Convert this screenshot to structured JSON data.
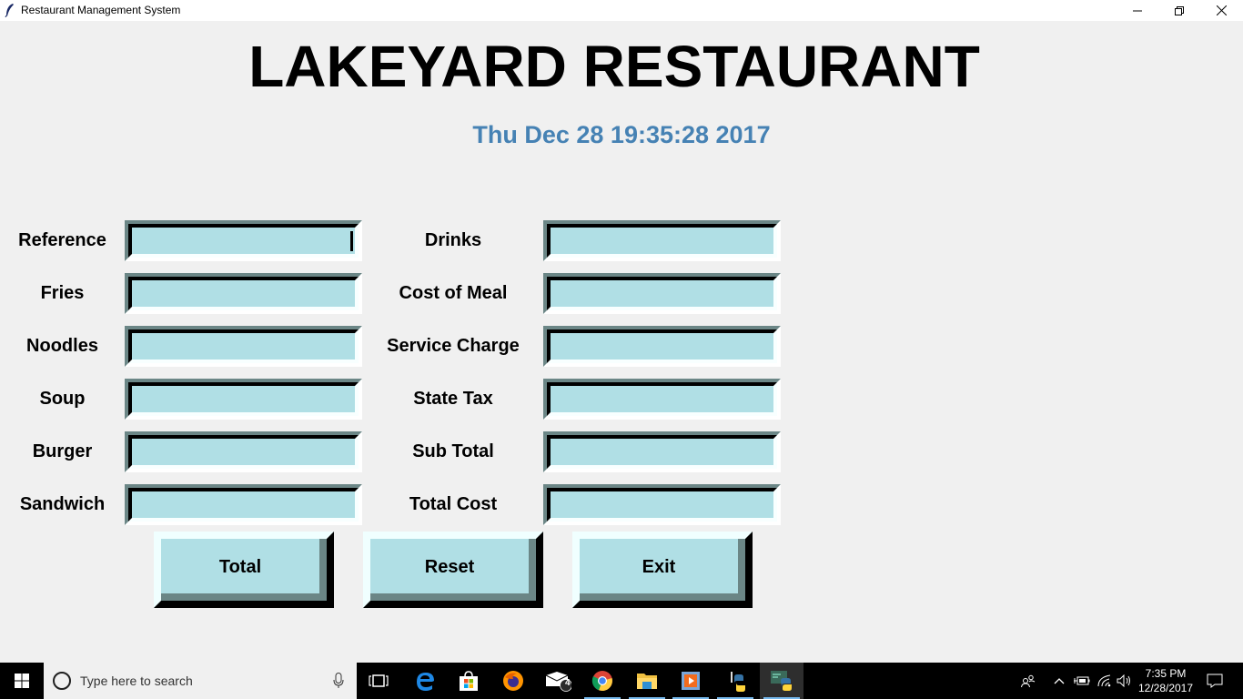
{
  "window": {
    "title": "Restaurant Management System",
    "icon": "feather-icon",
    "controls": [
      "minimize",
      "restore",
      "close"
    ]
  },
  "header": {
    "title": "LAKEYARD RESTAURANT",
    "datetime": "Thu Dec 28 19:35:28 2017",
    "datetime_color": "#4682b4"
  },
  "form": {
    "left": [
      {
        "label": "Reference",
        "value": ""
      },
      {
        "label": "Fries",
        "value": ""
      },
      {
        "label": "Noodles",
        "value": ""
      },
      {
        "label": "Soup",
        "value": ""
      },
      {
        "label": "Burger",
        "value": ""
      },
      {
        "label": "Sandwich",
        "value": ""
      }
    ],
    "right": [
      {
        "label": "Drinks",
        "value": ""
      },
      {
        "label": "Cost of Meal",
        "value": ""
      },
      {
        "label": "Service Charge",
        "value": ""
      },
      {
        "label": "State Tax",
        "value": ""
      },
      {
        "label": "Sub Total",
        "value": ""
      },
      {
        "label": "Total Cost",
        "value": ""
      }
    ],
    "entry_bg": "#b0dfe5"
  },
  "buttons": {
    "total": "Total",
    "reset": "Reset",
    "exit": "Exit"
  },
  "taskbar": {
    "search_placeholder": "Type here to search",
    "apps": [
      "task-view",
      "edge",
      "store",
      "firefox",
      "mail",
      "chrome",
      "file-explorer",
      "media-player",
      "python-idle",
      "python"
    ],
    "mail_badge": "4",
    "time": "7:35 PM",
    "date": "12/28/2017"
  }
}
